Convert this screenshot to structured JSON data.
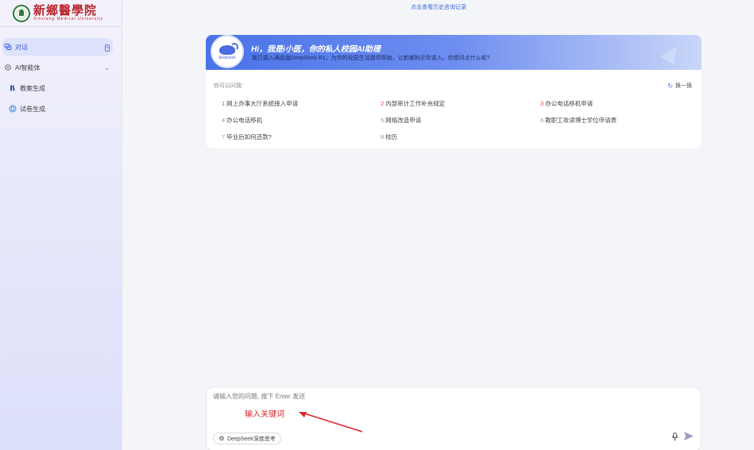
{
  "logo": {
    "cn": "新鄉醫學院",
    "en": "Xinxiang Medical University"
  },
  "sidebar": {
    "items": [
      {
        "label": "对话",
        "icon": "chat-icon"
      },
      {
        "label": "AI智能体",
        "icon": "robot-icon"
      },
      {
        "label": "教案生成",
        "icon": "book-icon"
      },
      {
        "label": "试卷生成",
        "icon": "exam-icon"
      }
    ]
  },
  "main": {
    "top_link": "点击查看历史咨询记录",
    "card": {
      "avatar_label": "deepseek",
      "greeting": "Hi，我是i小医，你的私人校园AI助理",
      "intro": "我已接入满血版DeepSeek R1，为你的校园生活提供帮助，让新鄉附近你请入。你想问点什么呢?",
      "questions_title": "你可以问我:",
      "refresh_label": "换一换",
      "questions": [
        {
          "num": "1",
          "text": "网上办事大厅系统接入申请"
        },
        {
          "num": "2",
          "text": "内部审计工作补充规定"
        },
        {
          "num": "3",
          "text": "办公电话移机申请"
        },
        {
          "num": "4",
          "text": "办公电话移机"
        },
        {
          "num": "5",
          "text": "网络改造申请"
        },
        {
          "num": "6",
          "text": "教职工攻读博士学位申请表"
        },
        {
          "num": "7",
          "text": "毕业后如何还款?"
        },
        {
          "num": "8",
          "text": "校历"
        }
      ]
    },
    "input": {
      "placeholder": "请输入您的问题, 按下 Enter 发送",
      "value": "",
      "annotation": "输入关键词",
      "deepseek_button": "DeepSeek深度思考"
    }
  },
  "colors": {
    "accent": "#4a6ce0",
    "hot": "#e24b2c",
    "annotation": "#d9252a"
  }
}
